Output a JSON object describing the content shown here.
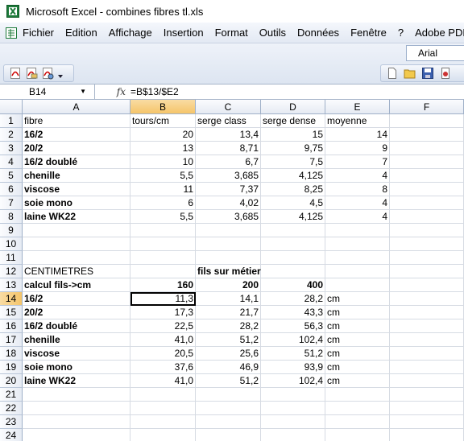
{
  "window": {
    "title": "Microsoft Excel - combines fibres tl.xls",
    "icon": "excel-icon"
  },
  "menu": [
    "Fichier",
    "Edition",
    "Affichage",
    "Insertion",
    "Format",
    "Outils",
    "Données",
    "Fenêtre",
    "?",
    "Adobe PDF"
  ],
  "toolbar": {
    "font_name": "Arial"
  },
  "formula_bar": {
    "name_box": "B14",
    "fx": "fx",
    "formula": "=B$13/$E2"
  },
  "columns": [
    "A",
    "B",
    "C",
    "D",
    "E",
    "F"
  ],
  "active_cell": {
    "column": "B",
    "row": 14
  },
  "rows": [
    {
      "n": "1",
      "cells": [
        "fibre",
        "tours/cm",
        "serge class",
        "serge dense",
        "moyenne",
        ""
      ]
    },
    {
      "n": "2",
      "cells": [
        " 16/2",
        "20",
        "13,4",
        "15",
        "14",
        ""
      ]
    },
    {
      "n": "3",
      "cells": [
        " 20/2",
        "13",
        "8,71",
        "9,75",
        "9",
        ""
      ]
    },
    {
      "n": "4",
      "cells": [
        " 16/2 doublé",
        "10",
        "6,7",
        "7,5",
        "7",
        ""
      ]
    },
    {
      "n": "5",
      "cells": [
        "chenille",
        "5,5",
        "3,685",
        "4,125",
        "4",
        ""
      ]
    },
    {
      "n": "6",
      "cells": [
        "viscose",
        "11",
        "7,37",
        "8,25",
        "8",
        ""
      ]
    },
    {
      "n": "7",
      "cells": [
        "soie mono",
        "6",
        "4,02",
        "4,5",
        "4",
        ""
      ]
    },
    {
      "n": "8",
      "cells": [
        "laine WK22",
        "5,5",
        "3,685",
        "4,125",
        "4",
        ""
      ]
    },
    {
      "n": "9",
      "cells": [
        "",
        "",
        "",
        "",
        "",
        ""
      ]
    },
    {
      "n": "10",
      "cells": [
        "",
        "",
        "",
        "",
        "",
        ""
      ]
    },
    {
      "n": "11",
      "cells": [
        "",
        "",
        "",
        "",
        "",
        ""
      ]
    },
    {
      "n": "12",
      "cells": [
        "CENTIMETRES",
        "",
        "fils sur métier",
        "",
        "",
        ""
      ]
    },
    {
      "n": "13",
      "cells": [
        "calcul fils->cm",
        "160",
        "200",
        "400",
        "",
        ""
      ]
    },
    {
      "n": "14",
      "cells": [
        " 16/2",
        "11,3",
        "14,1",
        "28,2",
        "cm",
        ""
      ]
    },
    {
      "n": "15",
      "cells": [
        " 20/2",
        "17,3",
        "21,7",
        "43,3",
        "cm",
        ""
      ]
    },
    {
      "n": "16",
      "cells": [
        " 16/2 doublé",
        "22,5",
        "28,2",
        "56,3",
        "cm",
        ""
      ]
    },
    {
      "n": "17",
      "cells": [
        "chenille",
        "41,0",
        "51,2",
        "102,4",
        "cm",
        ""
      ]
    },
    {
      "n": "18",
      "cells": [
        "viscose",
        "20,5",
        "25,6",
        "51,2",
        "cm",
        ""
      ]
    },
    {
      "n": "19",
      "cells": [
        "soie mono",
        "37,6",
        "46,9",
        "93,9",
        "cm",
        ""
      ]
    },
    {
      "n": "20",
      "cells": [
        "laine WK22",
        "41,0",
        "51,2",
        "102,4",
        "cm",
        ""
      ]
    },
    {
      "n": "21",
      "cells": [
        "",
        "",
        "",
        "",
        "",
        ""
      ]
    },
    {
      "n": "22",
      "cells": [
        "",
        "",
        "",
        "",
        "",
        ""
      ]
    },
    {
      "n": "23",
      "cells": [
        "",
        "",
        "",
        "",
        "",
        ""
      ]
    },
    {
      "n": "24",
      "cells": [
        "",
        "",
        "",
        "",
        "",
        ""
      ]
    }
  ]
}
